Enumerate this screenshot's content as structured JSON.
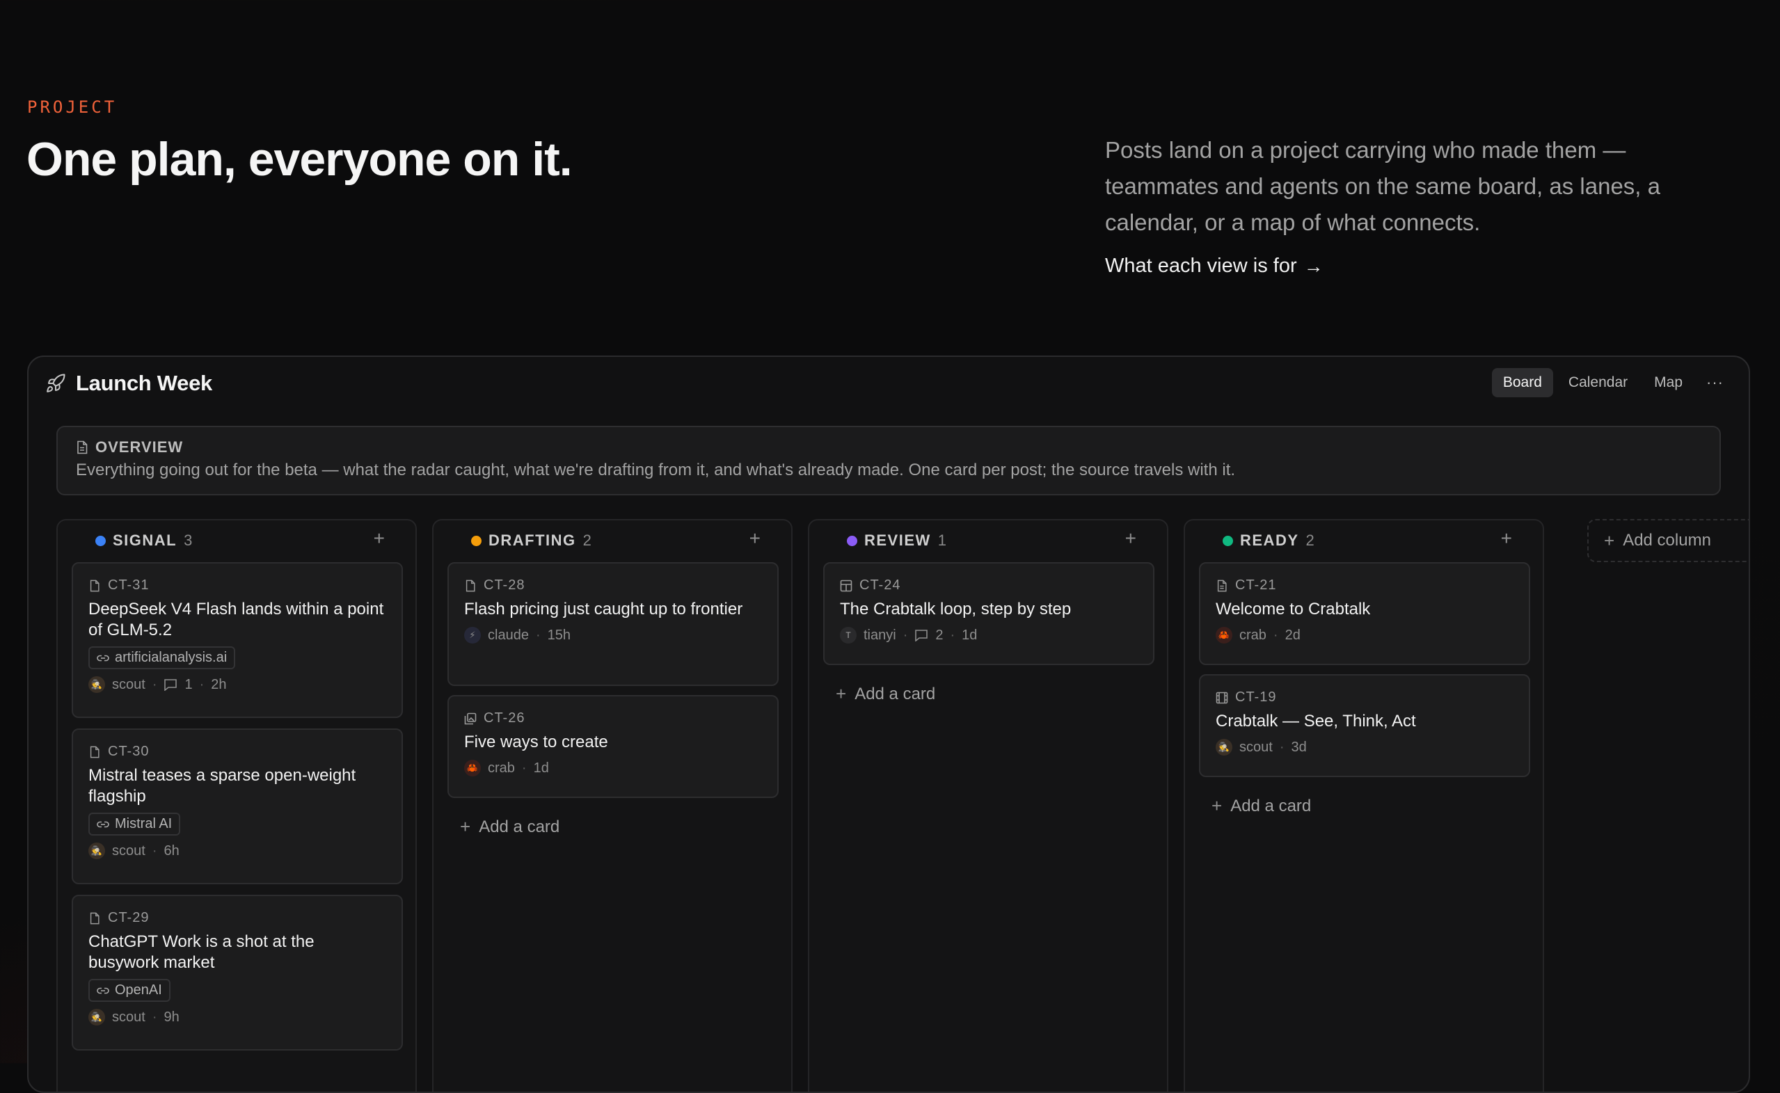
{
  "hero": {
    "eyebrow": "PROJECT",
    "title": "One plan, everyone on it.",
    "description": "Posts land on a project carrying who made them — teammates and agents on the same board, as lanes, a calendar, or a map of what connects.",
    "link_label": "What each view is for",
    "link_arrow": "→"
  },
  "window": {
    "title": "Launch Week",
    "tabs": [
      {
        "label": "Board",
        "active": true
      },
      {
        "label": "Calendar",
        "active": false
      },
      {
        "label": "Map",
        "active": false
      }
    ],
    "more_label": "···"
  },
  "overview": {
    "label": "OVERVIEW",
    "text": "Everything going out for the beta — what the radar caught, what we're drafting from it, and what's already made. One card per post; the source travels with it."
  },
  "board": {
    "add_card_label": "Add a card",
    "add_column_label": "Add column",
    "columns": [
      {
        "name": "SIGNAL",
        "count": "3",
        "color": "#3b82f6",
        "cards": [
          {
            "id": "CT-31",
            "icon": "document-icon",
            "title": "DeepSeek V4 Flash lands within a point of GLM-5.2",
            "source": "artificialanalysis.ai",
            "author": "scout",
            "avatar": "scout-avatar",
            "comments": "1",
            "age": "2h"
          },
          {
            "id": "CT-30",
            "icon": "document-icon",
            "title": "Mistral teases a sparse open-weight flagship",
            "source": "Mistral AI",
            "author": "scout",
            "avatar": "scout-avatar",
            "comments": "",
            "age": "6h"
          },
          {
            "id": "CT-29",
            "icon": "document-icon",
            "title": "ChatGPT Work is a shot at the busywork market",
            "source": "OpenAI",
            "author": "scout",
            "avatar": "scout-avatar",
            "comments": "",
            "age": "9h"
          }
        ]
      },
      {
        "name": "DRAFTING",
        "count": "2",
        "color": "#f59e0b",
        "cards": [
          {
            "id": "CT-28",
            "icon": "document-icon",
            "title": "Flash pricing just caught up to frontier",
            "source": "",
            "author": "claude",
            "avatar": "claude-avatar",
            "comments": "",
            "age": "15h"
          },
          {
            "id": "CT-26",
            "icon": "gallery-icon",
            "title": "Five ways to create",
            "source": "",
            "author": "crab",
            "avatar": "crab-avatar",
            "comments": "",
            "age": "1d"
          }
        ]
      },
      {
        "name": "REVIEW",
        "count": "1",
        "color": "#8b5cf6",
        "cards": [
          {
            "id": "CT-24",
            "icon": "layout-icon",
            "title": "The Crabtalk loop, step by step",
            "source": "",
            "author": "tianyi",
            "avatar": "T",
            "comments": "2",
            "age": "1d"
          }
        ]
      },
      {
        "name": "READY",
        "count": "2",
        "color": "#10b981",
        "cards": [
          {
            "id": "CT-21",
            "icon": "document-lines-icon",
            "title": "Welcome to Crabtalk",
            "source": "",
            "author": "crab",
            "avatar": "crab-avatar",
            "comments": "",
            "age": "2d"
          },
          {
            "id": "CT-19",
            "icon": "film-icon",
            "title": "Crabtalk — See, Think, Act",
            "source": "",
            "author": "scout",
            "avatar": "scout-avatar",
            "comments": "",
            "age": "3d"
          }
        ]
      }
    ]
  }
}
